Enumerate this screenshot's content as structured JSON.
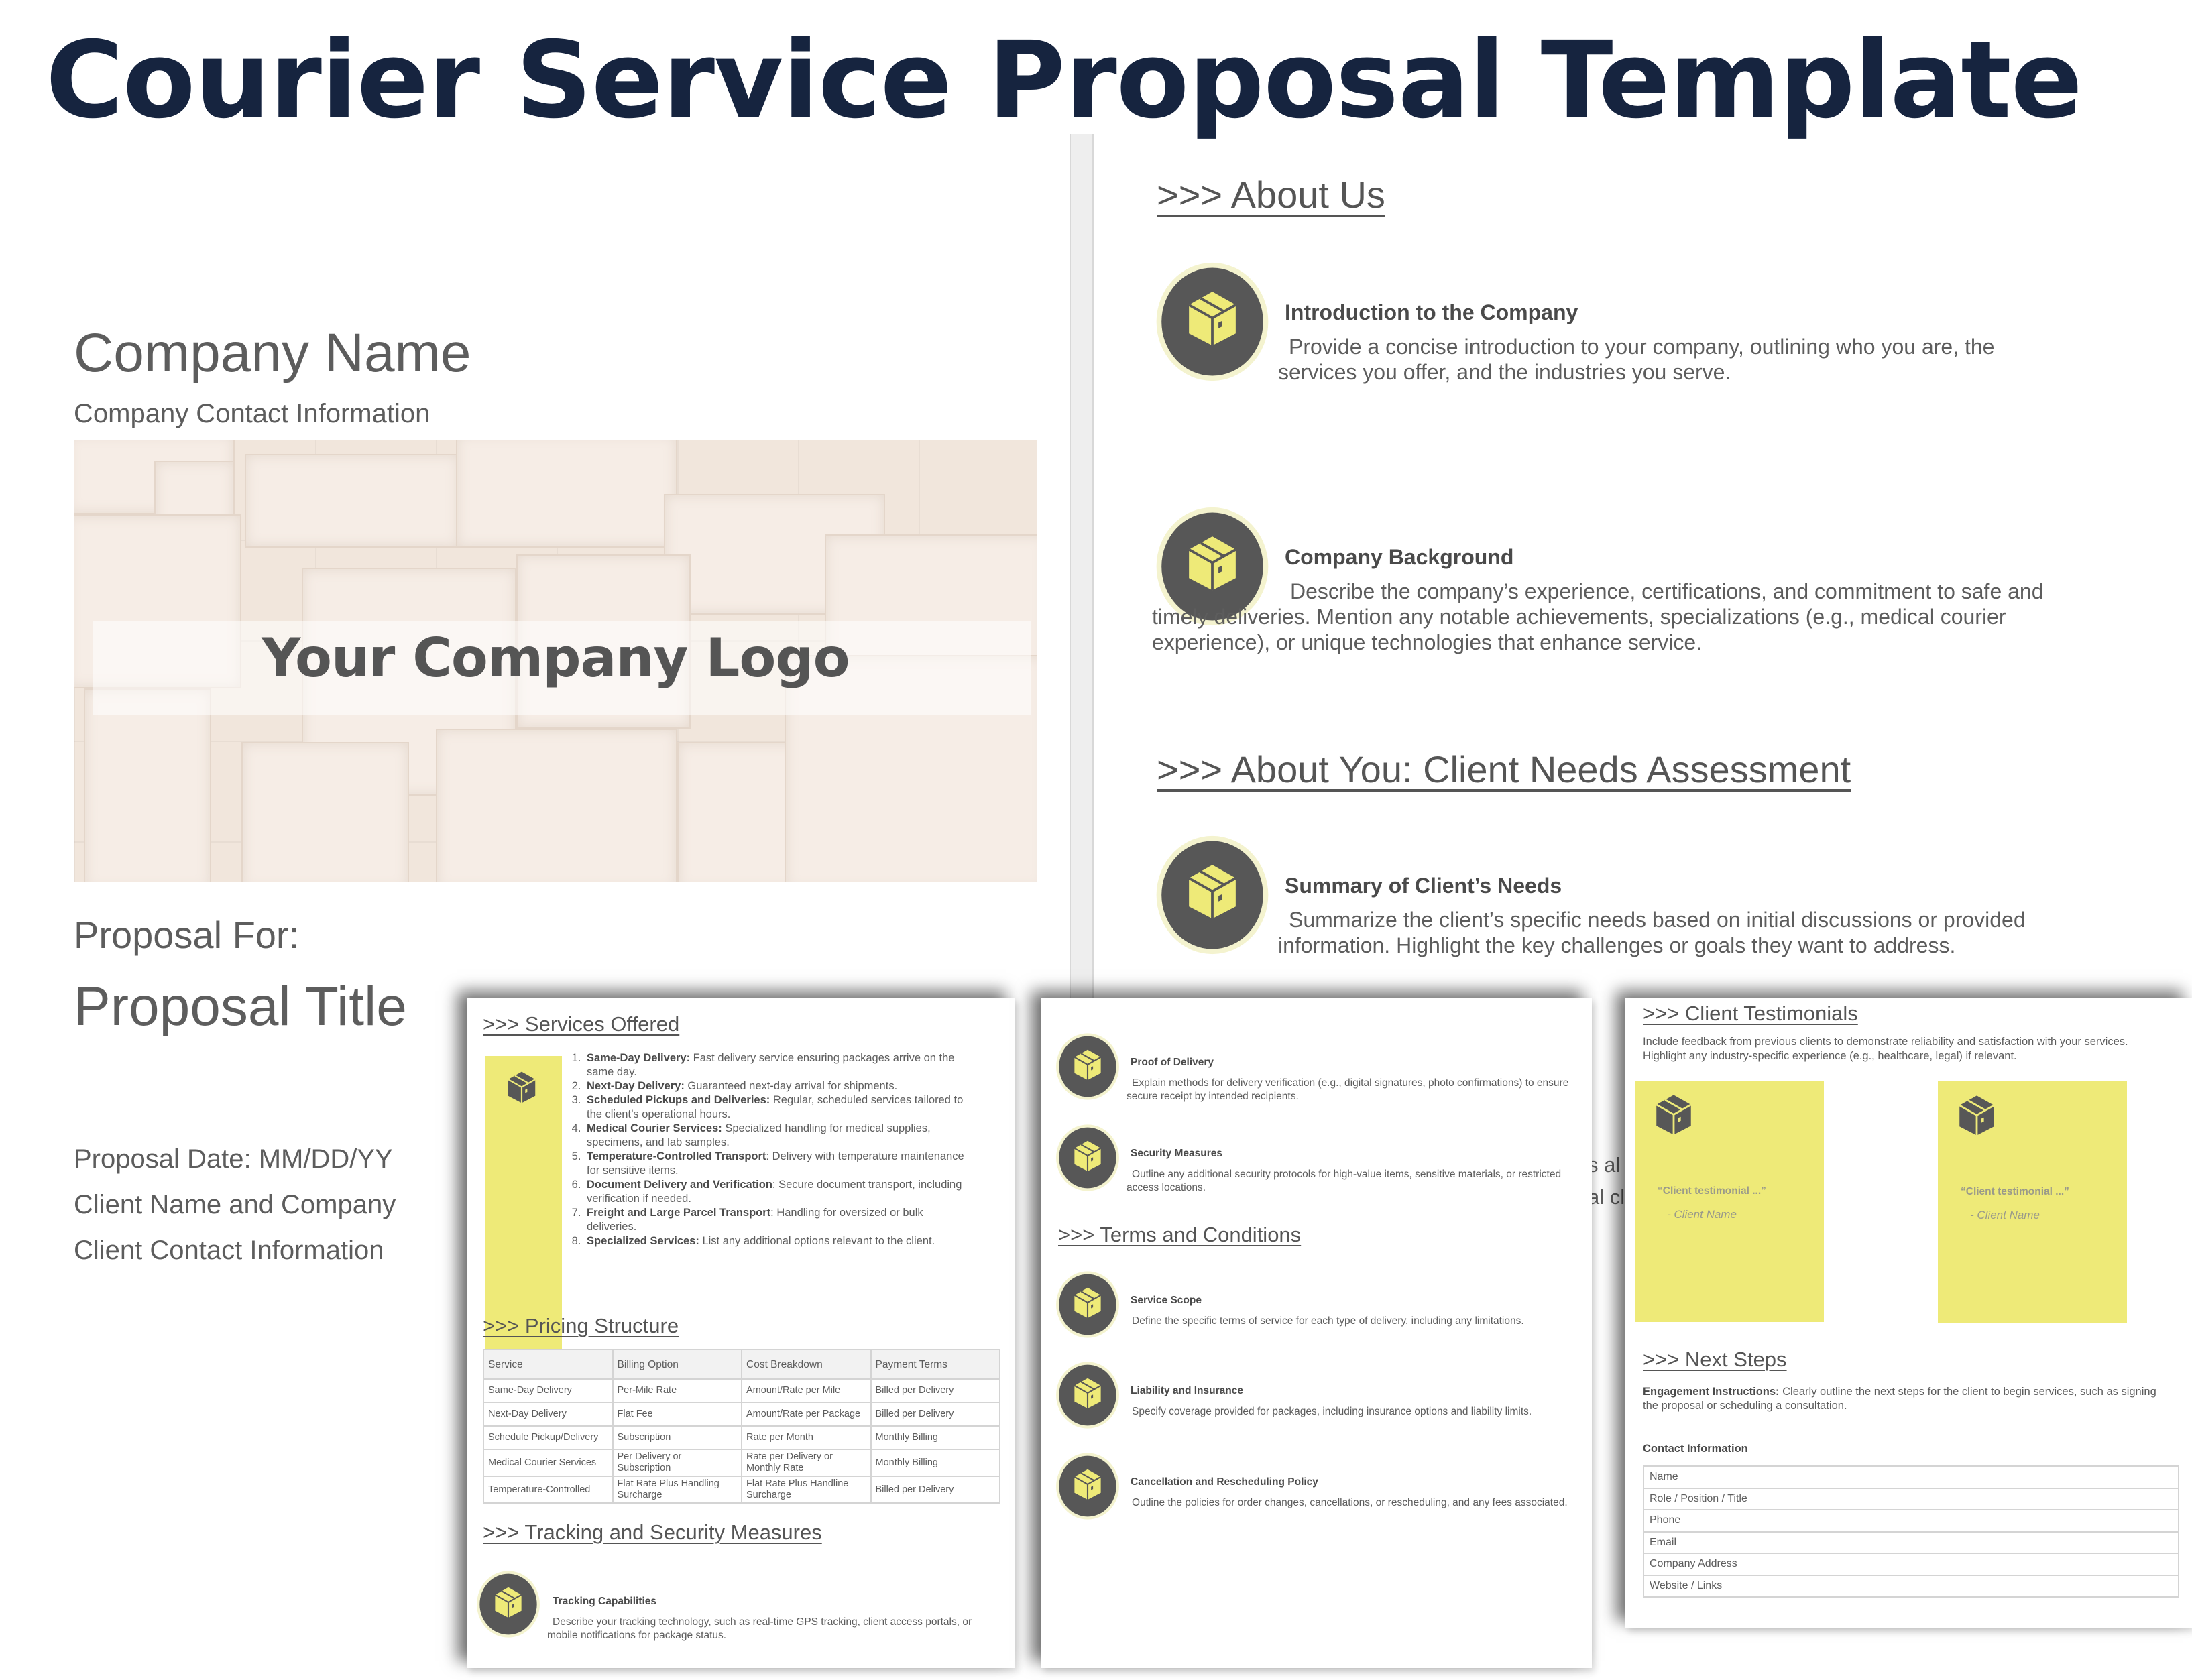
{
  "title": "Courier Service Proposal Template",
  "colors": {
    "title": "#16243f",
    "text": "#5d5d5d",
    "accent_yellow": "#eeea78",
    "badge_dark": "#575757",
    "badge_ring": "#f4f3cf"
  },
  "cover": {
    "company_name": "Company Name",
    "company_contact": "Company Contact Information",
    "logo_placeholder": "Your Company Logo",
    "proposal_for": "Proposal For:",
    "proposal_title": "Proposal Title",
    "proposal_date": "Proposal Date: MM/DD/YY",
    "client_name": "Client Name and Company",
    "client_contact": "Client Contact Information"
  },
  "about_page": {
    "about_us_heading": ">>> About Us",
    "intro": {
      "icon": "package-box-icon",
      "title": "Introduction to the Company",
      "body": "Provide a concise introduction to your company, outlining who you are, the services you offer, and the industries you serve."
    },
    "background": {
      "icon": "package-box-icon",
      "title": "Company Background",
      "body": "Describe the company’s experience, certifications, and commitment to safe and timely deliveries. Mention any notable achievements, specializations (e.g., medical courier experience), or unique technologies that enhance service."
    },
    "client_needs_heading": ">>> About You: Client Needs Assessment",
    "client_needs": {
      "icon": "package-box-icon",
      "title": "Summary of Client’s Needs",
      "body": "Summarize the client’s specific needs based on initial discussions or provided information. Highlight the key challenges or goals they want to address."
    },
    "peek_lines": [
      "s al",
      "al cl"
    ]
  },
  "page_services": {
    "services_heading": ">>> Services Offered",
    "services": [
      {
        "name": "Same-Day Delivery:",
        "desc": " Fast delivery service ensuring packages arrive on the same day."
      },
      {
        "name": "Next-Day Delivery:",
        "desc": " Guaranteed next-day arrival for shipments."
      },
      {
        "name": "Scheduled Pickups and Deliveries:",
        "desc": " Regular, scheduled services tailored to the client’s operational hours."
      },
      {
        "name": "Medical Courier Services:",
        "desc": " Specialized handling for medical supplies, specimens, and lab samples."
      },
      {
        "name": "Temperature-Controlled Transport",
        "desc": ": Delivery with temperature maintenance for sensitive items."
      },
      {
        "name": "Document Delivery and Verification",
        "desc": ": Secure document transport, including verification if needed."
      },
      {
        "name": "Freight and Large Parcel Transport",
        "desc": ": Handling for oversized or bulk deliveries."
      },
      {
        "name": "Specialized Services:",
        "desc": " List any additional options relevant to the client."
      }
    ],
    "pricing_heading": ">>> Pricing Structure",
    "pricing_table": {
      "columns": [
        "Service",
        "Billing Option",
        "Cost Breakdown",
        "Payment Terms"
      ],
      "rows": [
        [
          "Same-Day Delivery",
          "Per-Mile Rate",
          "Amount/Rate per Mile",
          "Billed per Delivery"
        ],
        [
          "Next-Day Delivery",
          "Flat Fee",
          "Amount/Rate per Package",
          "Billed per Delivery"
        ],
        [
          "Schedule Pickup/Delivery",
          "Subscription",
          "Rate per Month",
          "Monthly Billing"
        ],
        [
          "Medical Courier Services",
          "Per Delivery or Subscription",
          "Rate per Delivery or Monthly Rate",
          "Monthly Billing"
        ],
        [
          "Temperature-Controlled",
          "Flat Rate Plus Handling Surcharge",
          "Flat Rate Plus Handline Surcharge",
          "Billed per Delivery"
        ]
      ]
    },
    "tracking_heading": ">>> Tracking and Security Measures",
    "tracking": {
      "icon": "package-box-icon",
      "title": "Tracking Capabilities",
      "body": "Describe your tracking technology, such as real-time GPS tracking, client access portals, or mobile notifications for package status."
    }
  },
  "page_terms": {
    "items_top": [
      {
        "icon": "package-box-icon",
        "title": "Proof of Delivery",
        "body": "Explain methods for delivery verification (e.g., digital signatures, photo confirmations) to ensure secure receipt by intended recipients."
      },
      {
        "icon": "package-box-icon",
        "title": "Security Measures",
        "body": "Outline any additional security protocols for high-value items, sensitive materials, or restricted access locations."
      }
    ],
    "terms_heading": ">>> Terms and Conditions",
    "items_terms": [
      {
        "icon": "package-box-icon",
        "title": "Service Scope",
        "body": "Define the specific terms of service for each type of delivery, including any limitations."
      },
      {
        "icon": "package-box-icon",
        "title": "Liability and Insurance",
        "body": "Specify coverage provided for packages, including insurance options and liability limits."
      },
      {
        "icon": "package-box-icon",
        "title": "Cancellation and Rescheduling Policy",
        "body": "Outline the policies for order changes, cancellations, or rescheduling, and any fees associated."
      }
    ]
  },
  "page_testimonials": {
    "testimonials_heading": ">>> Client Testimonials",
    "testimonials_intro": "Include feedback from previous clients to demonstrate reliability and satisfaction with your services. Highlight any industry-specific experience (e.g., healthcare, legal) if relevant.",
    "testimonials": [
      {
        "quote": "“Client testimonial ...”",
        "name": "-    Client Name"
      },
      {
        "quote": "“Client testimonial ...”",
        "name": "-    Client Name"
      }
    ],
    "next_steps_heading": ">>> Next Steps",
    "engagement_label": "Engagement Instructions:",
    "engagement_text": " Clearly outline the next steps for the client to begin services, such as signing the proposal or scheduling a consultation.",
    "contact_heading": "Contact Information",
    "contact_fields": [
      "Name",
      "Role / Position / Title",
      "Phone",
      "Email",
      "Company Address",
      "Website / Links"
    ]
  }
}
